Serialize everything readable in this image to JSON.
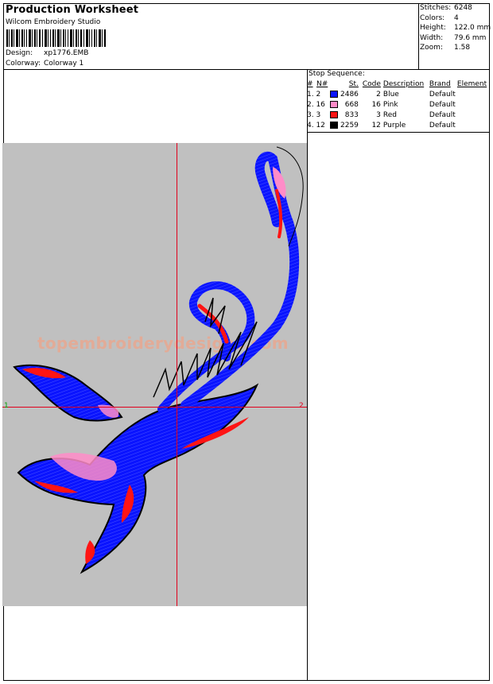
{
  "header": {
    "title": "Production Worksheet",
    "company": "Wilcom Embroidery Studio",
    "design_label": "Design:",
    "design_value": "xp1776.EMB",
    "colorway_label": "Colorway:",
    "colorway_value": "Colorway 1"
  },
  "stats": [
    {
      "label": "Stitches:",
      "value": "6248"
    },
    {
      "label": "Colors:",
      "value": "4"
    },
    {
      "label": "Height:",
      "value": "122.0 mm"
    },
    {
      "label": "Width:",
      "value": "79.6 mm"
    },
    {
      "label": "Zoom:",
      "value": "1.58"
    }
  ],
  "stop_sequence": {
    "title": "Stop Sequence:",
    "columns": [
      "#",
      "N#",
      "St.",
      "Code",
      "Description",
      "Brand",
      "Element"
    ],
    "rows": [
      {
        "num": "1. 2",
        "color": "#0a14ff",
        "st": "2486",
        "code": "2",
        "desc": "Blue",
        "brand": "Default"
      },
      {
        "num": "2. 16",
        "color": "#ff8cc8",
        "st": "668",
        "code": "16",
        "desc": "Pink",
        "brand": "Default"
      },
      {
        "num": "3. 3",
        "color": "#ff1414",
        "st": "833",
        "code": "3",
        "desc": "Red",
        "brand": "Default"
      },
      {
        "num": "4. 12",
        "color": "#000000",
        "st": "2259",
        "code": "12",
        "desc": "Purple",
        "brand": "Default"
      }
    ]
  },
  "preview": {
    "axis_left": "1",
    "axis_right": "2",
    "watermark": "topembroiderydesigns.com",
    "colors": {
      "background": "#c0c0c0",
      "crosshair": "#e0001c",
      "blue": "#0a14ff",
      "pink": "#ff8cc8",
      "red": "#ff1414",
      "outline": "#000000"
    }
  }
}
